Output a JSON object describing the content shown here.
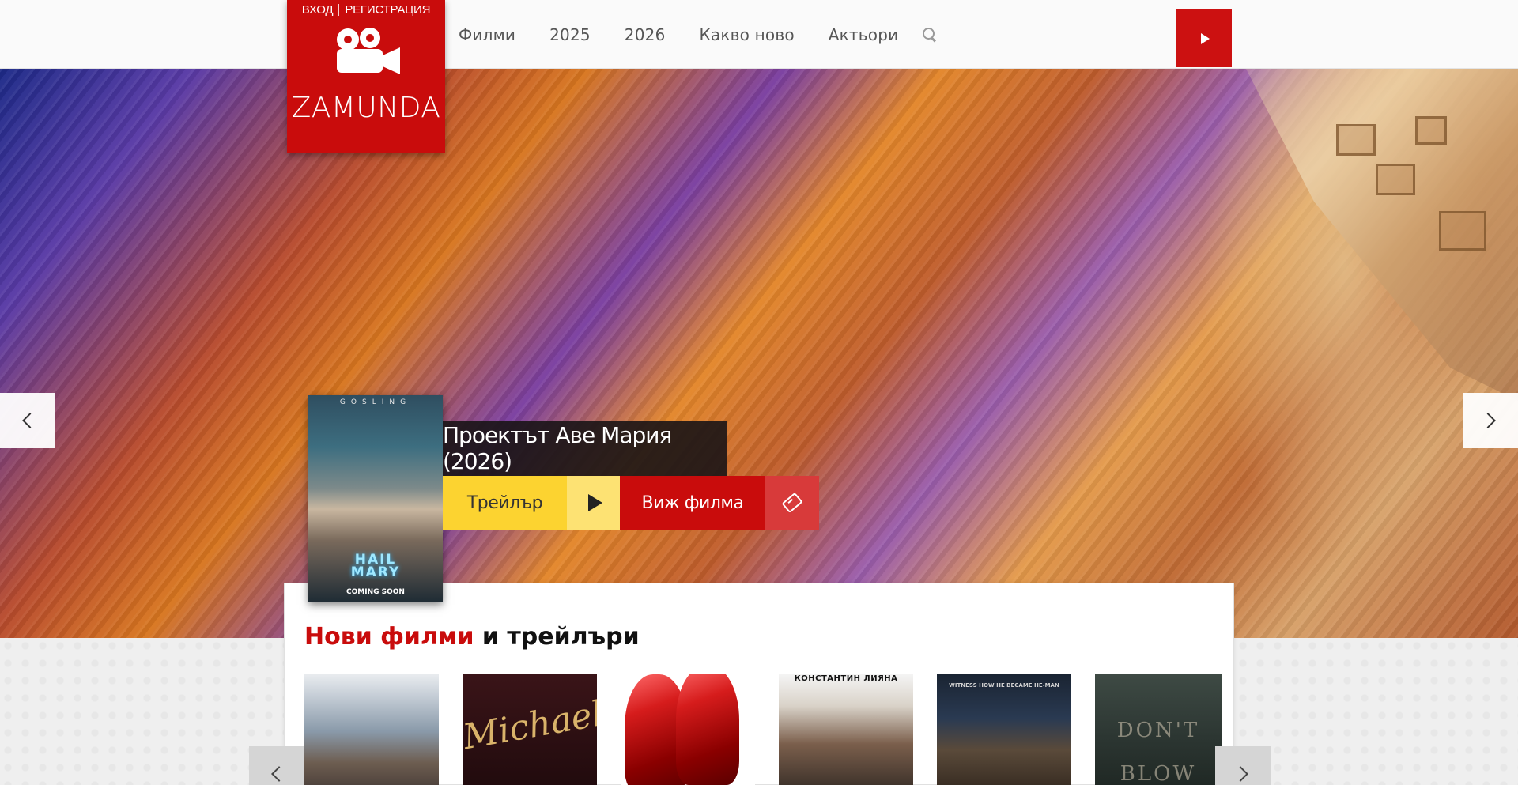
{
  "header": {
    "auth": {
      "login": "ВХОД",
      "register": "РЕГИСТРАЦИЯ"
    },
    "brand": "ZAMUNDA",
    "nav": [
      "Филми",
      "2025",
      "2026",
      "Какво ново",
      "Актьори"
    ],
    "accent_color": "#c90c0c"
  },
  "hero": {
    "title": "Проектът Аве Мария (2026)",
    "poster": {
      "top_text": "GOSLING",
      "title_line1": "HAIL",
      "title_line2": "MARY",
      "bottom_text": "COMING SOON"
    },
    "trailer_label": "Трейлър",
    "watch_label": "Виж филма"
  },
  "section": {
    "title_red": "Нови филми",
    "title_rest": "и трейлъри",
    "thumbs": [
      {
        "text": ""
      },
      {
        "text": "Michael"
      },
      {
        "text": ""
      },
      {
        "text": "КОНСТАНТИН     ЛИЯНА"
      },
      {
        "text": "WITNESS HOW HE BECAME HE-MAN"
      },
      {
        "text": "DON'T BLOW"
      }
    ]
  }
}
